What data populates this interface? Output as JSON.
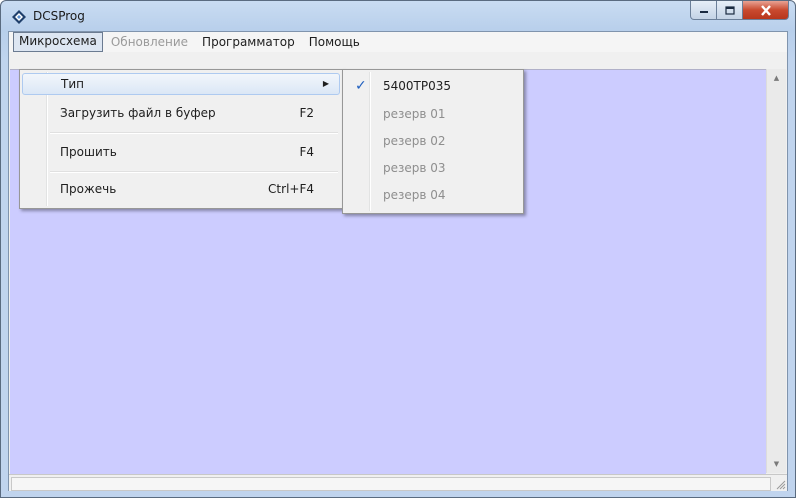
{
  "window": {
    "title": "DCSProg"
  },
  "menubar": {
    "items": [
      {
        "label": "Микросхема"
      },
      {
        "label": "Обновление"
      },
      {
        "label": "Программатор"
      },
      {
        "label": "Помощь"
      }
    ]
  },
  "dropdown": {
    "items": [
      {
        "label": "Тип",
        "shortcut": ""
      },
      {
        "label": "Загрузить файл в буфер",
        "shortcut": "F2"
      },
      {
        "label": "Прошить",
        "shortcut": "F4"
      },
      {
        "label": "Прожечь",
        "shortcut": "Ctrl+F4"
      }
    ]
  },
  "submenu": {
    "items": [
      {
        "label": "5400ТР035",
        "checked": true
      },
      {
        "label": "резерв 01"
      },
      {
        "label": "резерв 02"
      },
      {
        "label": "резерв 03"
      },
      {
        "label": "резерв 04"
      }
    ]
  },
  "colors": {
    "workspace": "#ccccff",
    "close_button": "#c94a2f",
    "highlight_border": "#aecaf0"
  },
  "icons": [
    "app-diamond-icon",
    "minimize-icon",
    "maximize-icon",
    "close-icon",
    "submenu-arrow-icon",
    "checkmark-icon",
    "scroll-up-icon",
    "scroll-down-icon",
    "resize-grip-icon"
  ]
}
